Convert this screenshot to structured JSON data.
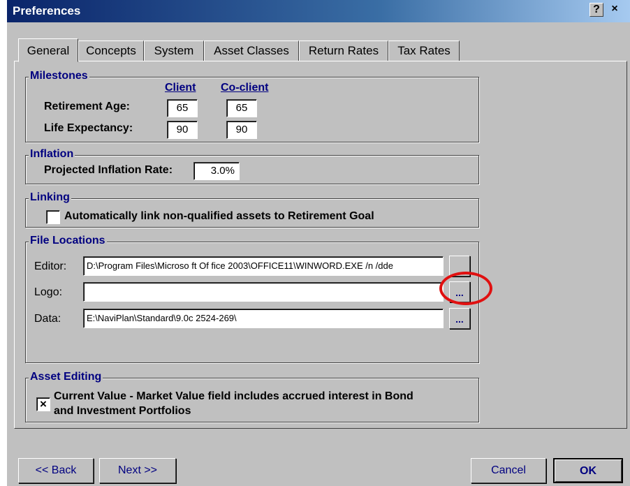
{
  "window": {
    "title": "Preferences",
    "help_label": "?",
    "close_label": "×"
  },
  "tabs": [
    {
      "label": "General"
    },
    {
      "label": "Concepts"
    },
    {
      "label": "System"
    },
    {
      "label": "Asset Classes"
    },
    {
      "label": "Return Rates"
    },
    {
      "label": "Tax Rates"
    }
  ],
  "milestones": {
    "legend": "Milestones",
    "col_client": "Client",
    "col_coclient": "Co-client",
    "retirement_label": "Retirement Age:",
    "retirement_client": "65",
    "retirement_coclient": "65",
    "life_label": "Life Expectancy:",
    "life_client": "90",
    "life_coclient": "90"
  },
  "inflation": {
    "legend": "Inflation",
    "rate_label": "Projected Inflation Rate:",
    "rate_value": "3.0%"
  },
  "linking": {
    "legend": "Linking",
    "checkbox_label": "Automatically link non-qualified assets to Retirement Goal",
    "checked": false
  },
  "file_locations": {
    "legend": "File Locations",
    "editor_label": "Editor:",
    "editor_value": "D:\\Program Files\\Microso ft Of fice 2003\\OFFICE11\\WINWORD.EXE /n /dde",
    "logo_label": "Logo:",
    "logo_value": "",
    "data_label": "Data:",
    "data_value": "E:\\NaviPlan\\Standard\\9.0c 2524-269\\",
    "browse_label": "..."
  },
  "asset_editing": {
    "legend": "Asset Editing",
    "checkbox_mark": "×",
    "checkbox_line1": "Current Value - Market Value field includes accrued interest in Bond",
    "checkbox_line2": "and Investment Portfolios",
    "checked": true
  },
  "buttons": {
    "back": "<< Back",
    "next": "Next >>",
    "cancel": "Cancel",
    "ok": "OK"
  },
  "colors": {
    "accent": "#000080",
    "highlight": "#e01010",
    "title_bar": "#0a246a"
  }
}
